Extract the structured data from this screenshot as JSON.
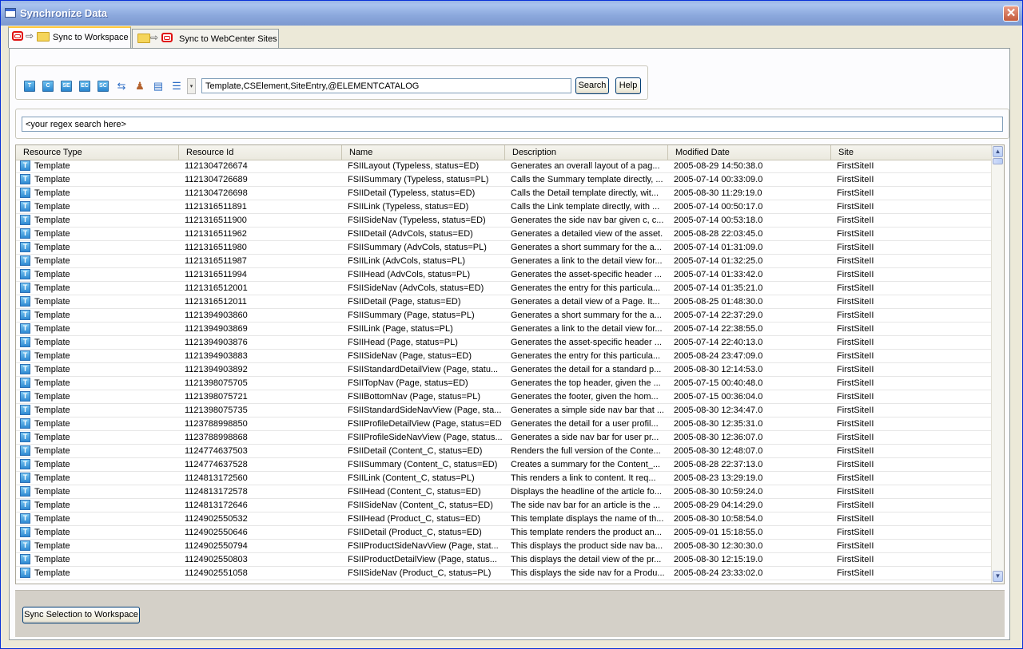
{
  "window": {
    "title": "Synchronize Data",
    "close_glyph": "✕"
  },
  "tabs": [
    {
      "label": "Sync to Workspace",
      "active": true
    },
    {
      "label": "Sync to WebCenter Sites",
      "active": false
    }
  ],
  "toolbar": {
    "icons": [
      "T",
      "C",
      "SE",
      "EC",
      "SC"
    ],
    "search_value": "Template,CSElement,SiteEntry,@ELEMENTCATALOG",
    "search_label": "Search",
    "help_label": "Help",
    "dropdown_glyph": "▾"
  },
  "regex": {
    "value": "<your regex search here>"
  },
  "table": {
    "columns": [
      "Resource Type",
      "Resource Id",
      "Name",
      "Description",
      "Modified Date",
      "Site"
    ],
    "type_icon_glyph": "T",
    "rows": [
      [
        "Template",
        "1121304726674",
        "FSIILayout (Typeless, status=ED)",
        "Generates an overall layout of a pag...",
        "2005-08-29 14:50:38.0",
        "FirstSiteII"
      ],
      [
        "Template",
        "1121304726689",
        "FSIISummary (Typeless, status=PL)",
        "Calls the Summary template directly, ...",
        "2005-07-14 00:33:09.0",
        "FirstSiteII"
      ],
      [
        "Template",
        "1121304726698",
        "FSIIDetail (Typeless, status=ED)",
        "Calls the Detail template directly, wit...",
        "2005-08-30 11:29:19.0",
        "FirstSiteII"
      ],
      [
        "Template",
        "1121316511891",
        "FSIILink (Typeless, status=ED)",
        "Calls the Link template directly, with ...",
        "2005-07-14 00:50:17.0",
        "FirstSiteII"
      ],
      [
        "Template",
        "1121316511900",
        "FSIISideNav (Typeless, status=ED)",
        "Generates the side nav bar given c, c...",
        "2005-07-14 00:53:18.0",
        "FirstSiteII"
      ],
      [
        "Template",
        "1121316511962",
        "FSIIDetail (AdvCols, status=ED)",
        "Generates a detailed view of the asset.",
        "2005-08-28 22:03:45.0",
        "FirstSiteII"
      ],
      [
        "Template",
        "1121316511980",
        "FSIISummary (AdvCols, status=PL)",
        "Generates a short summary for the a...",
        "2005-07-14 01:31:09.0",
        "FirstSiteII"
      ],
      [
        "Template",
        "1121316511987",
        "FSIILink (AdvCols, status=PL)",
        "Generates a link to the detail view for...",
        "2005-07-14 01:32:25.0",
        "FirstSiteII"
      ],
      [
        "Template",
        "1121316511994",
        "FSIIHead (AdvCols, status=PL)",
        "Generates the asset-specific header ...",
        "2005-07-14 01:33:42.0",
        "FirstSiteII"
      ],
      [
        "Template",
        "1121316512001",
        "FSIISideNav (AdvCols, status=ED)",
        "Generates the entry for this particula...",
        "2005-07-14 01:35:21.0",
        "FirstSiteII"
      ],
      [
        "Template",
        "1121316512011",
        "FSIIDetail (Page, status=ED)",
        "Generates a detail view of a Page.  It...",
        "2005-08-25 01:48:30.0",
        "FirstSiteII"
      ],
      [
        "Template",
        "1121394903860",
        "FSIISummary (Page, status=PL)",
        "Generates a short summary for the a...",
        "2005-07-14 22:37:29.0",
        "FirstSiteII"
      ],
      [
        "Template",
        "1121394903869",
        "FSIILink (Page, status=PL)",
        "Generates a link to the detail view for...",
        "2005-07-14 22:38:55.0",
        "FirstSiteII"
      ],
      [
        "Template",
        "1121394903876",
        "FSIIHead (Page, status=PL)",
        "Generates the asset-specific header ...",
        "2005-07-14 22:40:13.0",
        "FirstSiteII"
      ],
      [
        "Template",
        "1121394903883",
        "FSIISideNav (Page, status=ED)",
        "Generates the entry for this particula...",
        "2005-08-24 23:47:09.0",
        "FirstSiteII"
      ],
      [
        "Template",
        "1121394903892",
        "FSIIStandardDetailView (Page, statu...",
        "Generates the detail for a standard p...",
        "2005-08-30 12:14:53.0",
        "FirstSiteII"
      ],
      [
        "Template",
        "1121398075705",
        "FSIITopNav (Page, status=ED)",
        "Generates the top header, given the ...",
        "2005-07-15 00:40:48.0",
        "FirstSiteII"
      ],
      [
        "Template",
        "1121398075721",
        "FSIIBottomNav (Page, status=PL)",
        "Generates the footer, given the hom...",
        "2005-07-15 00:36:04.0",
        "FirstSiteII"
      ],
      [
        "Template",
        "1121398075735",
        "FSIIStandardSideNavView (Page, sta...",
        "Generates a simple side nav bar that ...",
        "2005-08-30 12:34:47.0",
        "FirstSiteII"
      ],
      [
        "Template",
        "1123788998850",
        "FSIIProfileDetailView (Page, status=ED)",
        "Generates the detail for a user profil...",
        "2005-08-30 12:35:31.0",
        "FirstSiteII"
      ],
      [
        "Template",
        "1123788998868",
        "FSIIProfileSideNavView (Page, status...",
        "Generates a side nav bar for user pr...",
        "2005-08-30 12:36:07.0",
        "FirstSiteII"
      ],
      [
        "Template",
        "1124774637503",
        "FSIIDetail (Content_C, status=ED)",
        "Renders the full version of the Conte...",
        "2005-08-30 12:48:07.0",
        "FirstSiteII"
      ],
      [
        "Template",
        "1124774637528",
        "FSIISummary (Content_C, status=ED)",
        "Creates a summary for the Content_...",
        "2005-08-28 22:37:13.0",
        "FirstSiteII"
      ],
      [
        "Template",
        "1124813172560",
        "FSIILink (Content_C, status=PL)",
        "This renders a link to content.  It req...",
        "2005-08-23 13:29:19.0",
        "FirstSiteII"
      ],
      [
        "Template",
        "1124813172578",
        "FSIIHead (Content_C, status=ED)",
        "Displays the headline of the article fo...",
        "2005-08-30 10:59:24.0",
        "FirstSiteII"
      ],
      [
        "Template",
        "1124813172646",
        "FSIISideNav (Content_C, status=ED)",
        "The side nav bar for an article is the ...",
        "2005-08-29 04:14:29.0",
        "FirstSiteII"
      ],
      [
        "Template",
        "1124902550532",
        "FSIIHead (Product_C, status=ED)",
        "This template displays the name of th...",
        "2005-08-30 10:58:54.0",
        "FirstSiteII"
      ],
      [
        "Template",
        "1124902550646",
        "FSIIDetail (Product_C, status=ED)",
        "This template renders the product an...",
        "2005-09-01 15:18:55.0",
        "FirstSiteII"
      ],
      [
        "Template",
        "1124902550794",
        "FSIIProductSideNavView (Page, stat...",
        "This displays the product side nav ba...",
        "2005-08-30 12:30:30.0",
        "FirstSiteII"
      ],
      [
        "Template",
        "1124902550803",
        "FSIIProductDetailView (Page, status...",
        "This displays the detail view of the pr...",
        "2005-08-30 12:15:19.0",
        "FirstSiteII"
      ],
      [
        "Template",
        "1124902551058",
        "FSIISideNav (Product_C, status=PL)",
        "This displays the side nav for a Produ...",
        "2005-08-24 23:33:02.0",
        "FirstSiteII"
      ]
    ]
  },
  "footer": {
    "sync_button_label": "Sync Selection to Workspace"
  },
  "scrollbar": {
    "up_glyph": "▲",
    "down_glyph": "▼"
  },
  "colors": {
    "titlebar": "#8ba8dc",
    "tab_highlight": "#ffc83c",
    "type_icon": "#2f8ad2"
  }
}
